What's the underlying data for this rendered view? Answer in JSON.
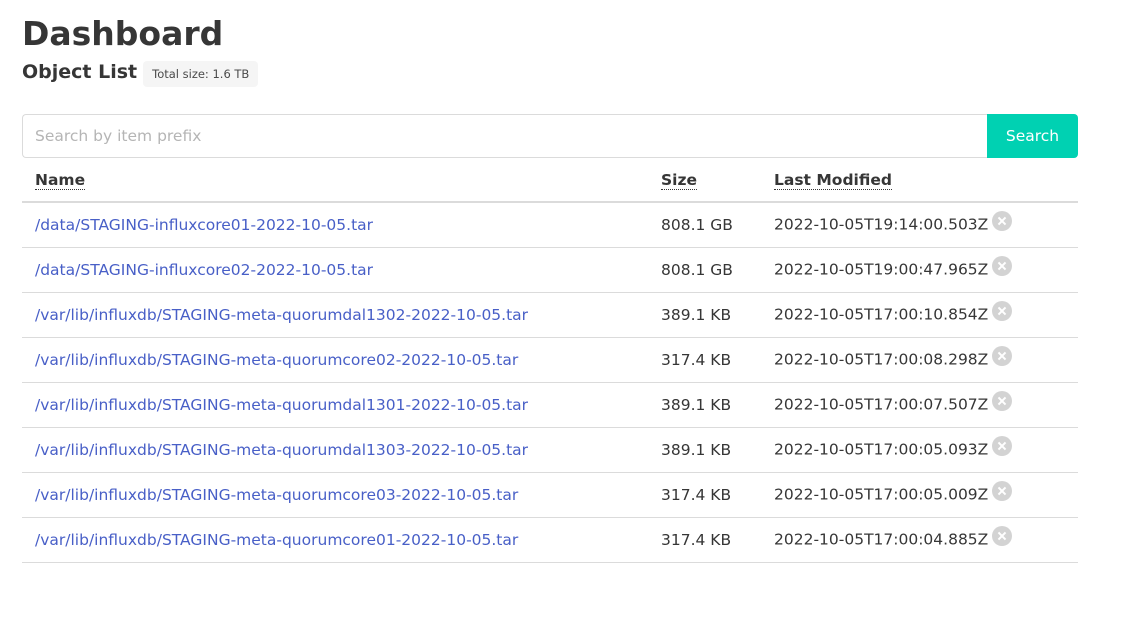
{
  "page": {
    "title": "Dashboard",
    "subtitle": "Object List",
    "total_size_tag": "Total size: 1.6 TB"
  },
  "search": {
    "placeholder": "Search by item prefix",
    "value": "",
    "button_label": "Search"
  },
  "table": {
    "columns": {
      "name": "Name",
      "size": "Size",
      "modified": "Last Modified"
    },
    "rows": [
      {
        "name": "/data/STAGING-influxcore01-2022-10-05.tar",
        "size": "808.1 GB",
        "modified": "2022-10-05T19:14:00.503Z"
      },
      {
        "name": "/data/STAGING-influxcore02-2022-10-05.tar",
        "size": "808.1 GB",
        "modified": "2022-10-05T19:00:47.965Z"
      },
      {
        "name": "/var/lib/influxdb/STAGING-meta-quorumdal1302-2022-10-05.tar",
        "size": "389.1 KB",
        "modified": "2022-10-05T17:00:10.854Z"
      },
      {
        "name": "/var/lib/influxdb/STAGING-meta-quorumcore02-2022-10-05.tar",
        "size": "317.4 KB",
        "modified": "2022-10-05T17:00:08.298Z"
      },
      {
        "name": "/var/lib/influxdb/STAGING-meta-quorumdal1301-2022-10-05.tar",
        "size": "389.1 KB",
        "modified": "2022-10-05T17:00:07.507Z"
      },
      {
        "name": "/var/lib/influxdb/STAGING-meta-quorumdal1303-2022-10-05.tar",
        "size": "389.1 KB",
        "modified": "2022-10-05T17:00:05.093Z"
      },
      {
        "name": "/var/lib/influxdb/STAGING-meta-quorumcore03-2022-10-05.tar",
        "size": "317.4 KB",
        "modified": "2022-10-05T17:00:05.009Z"
      },
      {
        "name": "/var/lib/influxdb/STAGING-meta-quorumcore01-2022-10-05.tar",
        "size": "317.4 KB",
        "modified": "2022-10-05T17:00:04.885Z"
      }
    ]
  },
  "colors": {
    "primary_button": "#00d1b2",
    "link": "#485fc7",
    "delete_icon": "#d3d3d3",
    "tag_background": "#f5f5f5"
  },
  "icons": {
    "row_action": "delete-icon"
  }
}
